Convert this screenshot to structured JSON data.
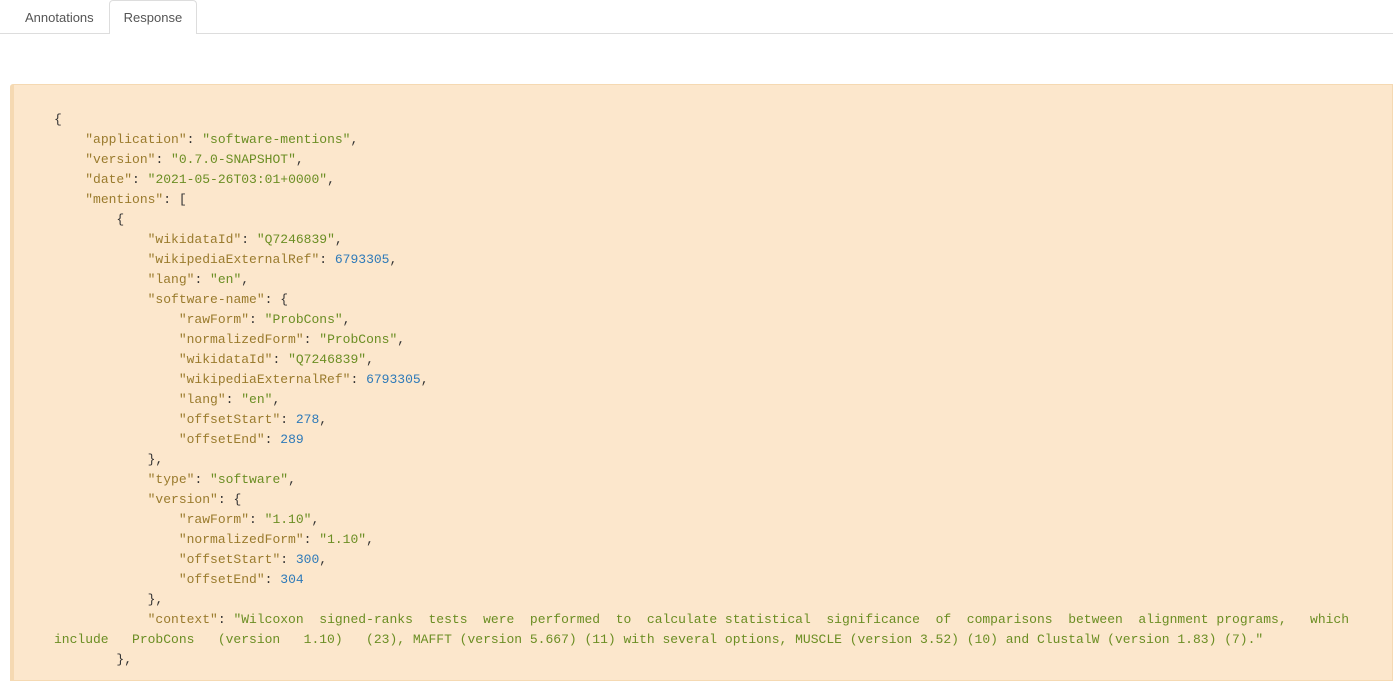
{
  "tabs": {
    "annotations": "Annotations",
    "response": "Response"
  },
  "json": {
    "indent": "    ",
    "lines": [
      {
        "depth": 0,
        "tokens": [
          {
            "t": "p",
            "v": "{"
          }
        ]
      },
      {
        "depth": 1,
        "tokens": [
          {
            "t": "k",
            "v": "\"application\""
          },
          {
            "t": "p",
            "v": ": "
          },
          {
            "t": "s",
            "v": "\"software-mentions\""
          },
          {
            "t": "p",
            "v": ","
          }
        ]
      },
      {
        "depth": 1,
        "tokens": [
          {
            "t": "k",
            "v": "\"version\""
          },
          {
            "t": "p",
            "v": ": "
          },
          {
            "t": "s",
            "v": "\"0.7.0-SNAPSHOT\""
          },
          {
            "t": "p",
            "v": ","
          }
        ]
      },
      {
        "depth": 1,
        "tokens": [
          {
            "t": "k",
            "v": "\"date\""
          },
          {
            "t": "p",
            "v": ": "
          },
          {
            "t": "s",
            "v": "\"2021-05-26T03:01+0000\""
          },
          {
            "t": "p",
            "v": ","
          }
        ]
      },
      {
        "depth": 1,
        "tokens": [
          {
            "t": "k",
            "v": "\"mentions\""
          },
          {
            "t": "p",
            "v": ": ["
          }
        ]
      },
      {
        "depth": 2,
        "tokens": [
          {
            "t": "p",
            "v": "{"
          }
        ]
      },
      {
        "depth": 3,
        "tokens": [
          {
            "t": "k",
            "v": "\"wikidataId\""
          },
          {
            "t": "p",
            "v": ": "
          },
          {
            "t": "s",
            "v": "\"Q7246839\""
          },
          {
            "t": "p",
            "v": ","
          }
        ]
      },
      {
        "depth": 3,
        "tokens": [
          {
            "t": "k",
            "v": "\"wikipediaExternalRef\""
          },
          {
            "t": "p",
            "v": ": "
          },
          {
            "t": "n",
            "v": "6793305"
          },
          {
            "t": "p",
            "v": ","
          }
        ]
      },
      {
        "depth": 3,
        "tokens": [
          {
            "t": "k",
            "v": "\"lang\""
          },
          {
            "t": "p",
            "v": ": "
          },
          {
            "t": "s",
            "v": "\"en\""
          },
          {
            "t": "p",
            "v": ","
          }
        ]
      },
      {
        "depth": 3,
        "tokens": [
          {
            "t": "k",
            "v": "\"software-name\""
          },
          {
            "t": "p",
            "v": ": {"
          }
        ]
      },
      {
        "depth": 4,
        "tokens": [
          {
            "t": "k",
            "v": "\"rawForm\""
          },
          {
            "t": "p",
            "v": ": "
          },
          {
            "t": "s",
            "v": "\"ProbCons\""
          },
          {
            "t": "p",
            "v": ","
          }
        ]
      },
      {
        "depth": 4,
        "tokens": [
          {
            "t": "k",
            "v": "\"normalizedForm\""
          },
          {
            "t": "p",
            "v": ": "
          },
          {
            "t": "s",
            "v": "\"ProbCons\""
          },
          {
            "t": "p",
            "v": ","
          }
        ]
      },
      {
        "depth": 4,
        "tokens": [
          {
            "t": "k",
            "v": "\"wikidataId\""
          },
          {
            "t": "p",
            "v": ": "
          },
          {
            "t": "s",
            "v": "\"Q7246839\""
          },
          {
            "t": "p",
            "v": ","
          }
        ]
      },
      {
        "depth": 4,
        "tokens": [
          {
            "t": "k",
            "v": "\"wikipediaExternalRef\""
          },
          {
            "t": "p",
            "v": ": "
          },
          {
            "t": "n",
            "v": "6793305"
          },
          {
            "t": "p",
            "v": ","
          }
        ]
      },
      {
        "depth": 4,
        "tokens": [
          {
            "t": "k",
            "v": "\"lang\""
          },
          {
            "t": "p",
            "v": ": "
          },
          {
            "t": "s",
            "v": "\"en\""
          },
          {
            "t": "p",
            "v": ","
          }
        ]
      },
      {
        "depth": 4,
        "tokens": [
          {
            "t": "k",
            "v": "\"offsetStart\""
          },
          {
            "t": "p",
            "v": ": "
          },
          {
            "t": "n",
            "v": "278"
          },
          {
            "t": "p",
            "v": ","
          }
        ]
      },
      {
        "depth": 4,
        "tokens": [
          {
            "t": "k",
            "v": "\"offsetEnd\""
          },
          {
            "t": "p",
            "v": ": "
          },
          {
            "t": "n",
            "v": "289"
          }
        ]
      },
      {
        "depth": 3,
        "tokens": [
          {
            "t": "p",
            "v": "},"
          }
        ]
      },
      {
        "depth": 3,
        "tokens": [
          {
            "t": "k",
            "v": "\"type\""
          },
          {
            "t": "p",
            "v": ": "
          },
          {
            "t": "s",
            "v": "\"software\""
          },
          {
            "t": "p",
            "v": ","
          }
        ]
      },
      {
        "depth": 3,
        "tokens": [
          {
            "t": "k",
            "v": "\"version\""
          },
          {
            "t": "p",
            "v": ": {"
          }
        ]
      },
      {
        "depth": 4,
        "tokens": [
          {
            "t": "k",
            "v": "\"rawForm\""
          },
          {
            "t": "p",
            "v": ": "
          },
          {
            "t": "s",
            "v": "\"1.10\""
          },
          {
            "t": "p",
            "v": ","
          }
        ]
      },
      {
        "depth": 4,
        "tokens": [
          {
            "t": "k",
            "v": "\"normalizedForm\""
          },
          {
            "t": "p",
            "v": ": "
          },
          {
            "t": "s",
            "v": "\"1.10\""
          },
          {
            "t": "p",
            "v": ","
          }
        ]
      },
      {
        "depth": 4,
        "tokens": [
          {
            "t": "k",
            "v": "\"offsetStart\""
          },
          {
            "t": "p",
            "v": ": "
          },
          {
            "t": "n",
            "v": "300"
          },
          {
            "t": "p",
            "v": ","
          }
        ]
      },
      {
        "depth": 4,
        "tokens": [
          {
            "t": "k",
            "v": "\"offsetEnd\""
          },
          {
            "t": "p",
            "v": ": "
          },
          {
            "t": "n",
            "v": "304"
          }
        ]
      },
      {
        "depth": 3,
        "tokens": [
          {
            "t": "p",
            "v": "},"
          }
        ]
      },
      {
        "depth": 3,
        "tokens": [
          {
            "t": "k",
            "v": "\"context\""
          },
          {
            "t": "p",
            "v": ": "
          },
          {
            "t": "s",
            "v": "\"Wilcoxon  signed-ranks  tests  were  performed  to  calculate statistical  significance  of  comparisons  between  alignment programs,   which  include   ProbCons   (version   1.10)   (23), MAFFT (version 5.667) (11) with several options, MUSCLE (version 3.52) (10) and ClustalW (version 1.83) (7).\""
          }
        ],
        "wrap": true
      },
      {
        "depth": 2,
        "tokens": [
          {
            "t": "p",
            "v": "},"
          }
        ]
      }
    ]
  }
}
